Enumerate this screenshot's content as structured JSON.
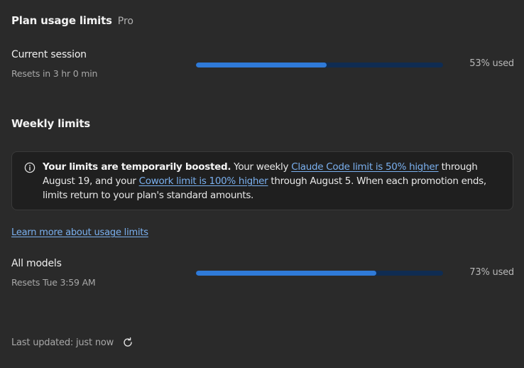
{
  "header": {
    "title": "Plan usage limits",
    "plan": "Pro"
  },
  "session": {
    "label": "Current session",
    "reset": "Resets in 3 hr 0 min",
    "percent": 53,
    "percent_label": "53% used"
  },
  "weekly": {
    "title": "Weekly limits",
    "notice": {
      "bold": "Your limits are temporarily boosted.",
      "text1": " Your weekly ",
      "link1": "Claude Code limit is 50% higher",
      "text2": " through August 19, and your ",
      "link2": "Cowork limit is 100% higher",
      "text3": " through August 5. When each promotion ends, limits return to your plan's standard amounts."
    },
    "learn_more": "Learn more about usage limits",
    "all_models": {
      "label": "All models",
      "reset": "Resets Tue 3:59 AM",
      "percent": 73,
      "percent_label": "73% used"
    }
  },
  "footer": {
    "updated": "Last updated: just now"
  },
  "icons": {
    "notice": "info-icon",
    "refresh": "refresh-icon"
  },
  "colors": {
    "bar_fill": "#2f7ad8",
    "bar_track": "#0f2c52",
    "link": "#7ab0ef",
    "background": "#2a2a2a"
  }
}
